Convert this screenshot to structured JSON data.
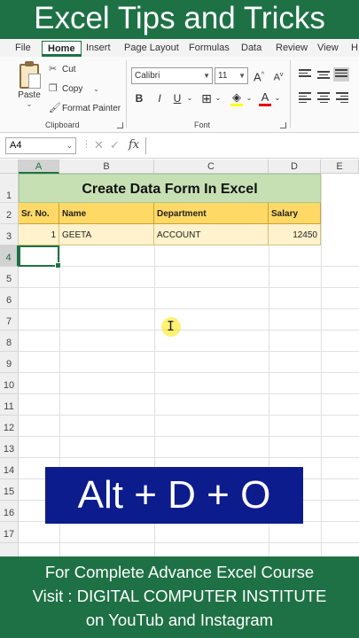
{
  "banner": {
    "top": "Excel Tips and Tricks",
    "bottom": [
      "For Complete Advance Excel Course",
      "Visit : DIGITAL COMPUTER INSTITUTE",
      "on YouTub and Instagram"
    ]
  },
  "tabs": [
    "File",
    "Home",
    "Insert",
    "Page Layout",
    "Formulas",
    "Data",
    "Review",
    "View",
    "H"
  ],
  "ribbon": {
    "clipboard": {
      "paste": "Paste",
      "cut": "Cut",
      "copy": "Copy",
      "format_painter": "Format Painter",
      "label": "Clipboard"
    },
    "font": {
      "name": "Calibri",
      "size": "11",
      "grow": "A",
      "shrink": "A",
      "bold": "B",
      "italic": "I",
      "underline": "U",
      "font_color": "A",
      "label": "Font"
    }
  },
  "formula_bar": {
    "name_box": "A4",
    "cancel": "✕",
    "enter": "✓",
    "fx": "fx"
  },
  "columns": [
    "A",
    "B",
    "C",
    "D",
    "E"
  ],
  "rows": [
    "1",
    "2",
    "3",
    "4",
    "5",
    "6",
    "7",
    "8",
    "9",
    "10",
    "11",
    "12",
    "13",
    "14",
    "15",
    "16",
    "17"
  ],
  "sheet": {
    "title": "Create Data Form In Excel",
    "headers": [
      "Sr. No.",
      "Name",
      "Department",
      "Salary"
    ],
    "record": [
      "1",
      "GEETA",
      "ACCOUNT",
      "12450"
    ]
  },
  "shortcut": "Alt + D + O",
  "colors": {
    "excel_green": "#1e7145",
    "title_fill": "#c6e0b4",
    "header_fill": "#ffd966",
    "row_fill": "#fff2cc",
    "shortcut_bg": "#0c1c8c"
  }
}
